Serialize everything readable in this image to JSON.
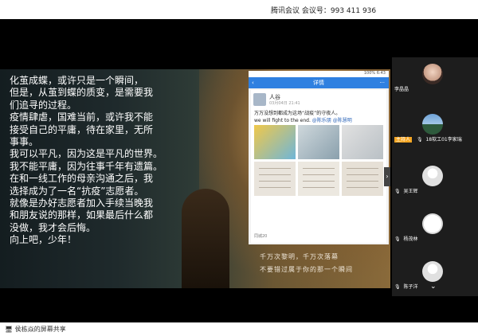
{
  "header": {
    "title": "腾讯会议 会议号：993 411 936"
  },
  "slide": {
    "poem_lines": [
      "化茧成蝶，或许只是一个瞬间，",
      "但是，从茧到蝶的质变，是需要我",
      "们追寻的过程。",
      "疫情肆虐，国难当前，或许我不能",
      "接受自己的平庸，待在家里，无所",
      "事事。",
      "我可以平凡，因为这是平凡的世界。",
      "我不能平庸，因为往事千年有遗篇。",
      "在和一线工作的母亲沟通之后，我",
      "选择成为了一名“抗疫”志愿者。",
      "就像是办好志愿者加入手续当晚我",
      "和朋友说的那样，如果最后什么都",
      "没做，我才会后悔。",
      "向上吧，少年！"
    ],
    "phone": {
      "status_text": "100% 6:43",
      "nav_title": "详情",
      "post_user": "人谷",
      "post_time": "03月04日 21:41",
      "post_line1": "万万没想到都成为这场“战疫”的守夜人。",
      "post_line2_prefix": "we will fight to the end.",
      "post_line2_mentions": "@陈乐朋 @陈慧明",
      "caption": "同城20"
    },
    "tail_line1": "千万次黎明，千万次落幕",
    "tail_line2": "不要错过属于你的那一个瞬间"
  },
  "participants": [
    {
      "name": "李晶晶",
      "host": false
    },
    {
      "name": "18软工01李家瑞",
      "host": true,
      "badge": "主持人"
    },
    {
      "name": "吴王辉",
      "host": false
    },
    {
      "name": "杨茂林",
      "host": false
    },
    {
      "name": "陈子洋",
      "host": false
    }
  ],
  "footer": {
    "share_text": "侯栋焱的屏幕共享"
  },
  "colors": {
    "accent": "#2f80e0",
    "host_badge": "#f5a623"
  }
}
